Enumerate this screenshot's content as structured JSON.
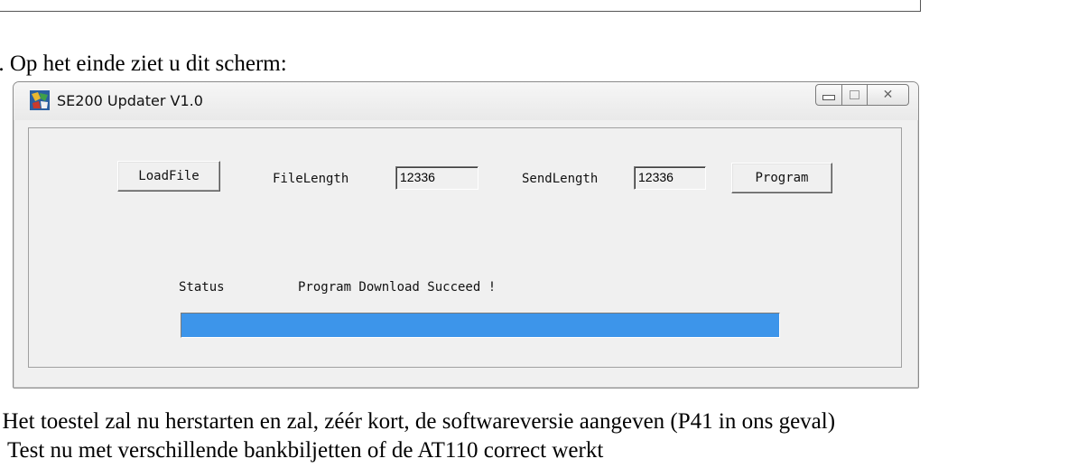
{
  "document": {
    "step_prefix": ". Op het einde ziet u dit scherm:",
    "step_number_partial": ")",
    "bottom_line": ". Het toestel zal nu herstarten en zal, zéér kort, de softwareversie aangeven (P41 in ons geval)",
    "bottom_line_cut": "Test nu met verschillende bankbiljetten of de AT110 correct werkt"
  },
  "window": {
    "title": "SE200 Updater V1.0",
    "icon": "app-icon",
    "controls": [
      "minimize-icon",
      "maximize-icon",
      "close-icon"
    ]
  },
  "form": {
    "load_label": "LoadFile",
    "file_length_label": "FileLength",
    "file_length_value": "12336",
    "send_length_label": "SendLength",
    "send_length_value": "12336",
    "program_label": "Program",
    "status_label": "Status",
    "status_text": "Program Download Succeed !",
    "progress_fraction": 1.0
  },
  "colors": {
    "progress": "#3d95ea"
  }
}
